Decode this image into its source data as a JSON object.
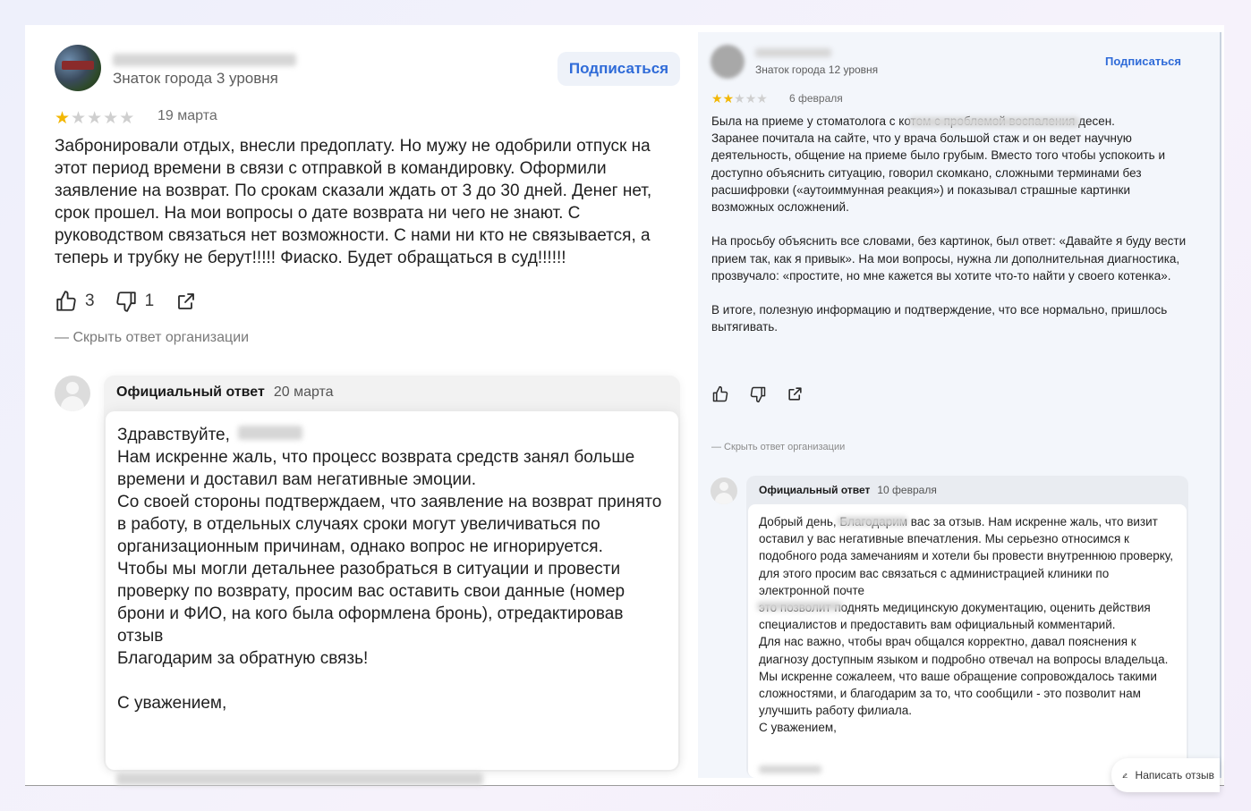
{
  "left_review": {
    "author_level": "Знаток города 3 уровня",
    "subscribe_label": "Подписаться",
    "rating": 1,
    "date": "19 марта",
    "text": "Забронировали отдых, внесли предоплату. Но мужу не одобрили отпуск на этот период времени в связи с отправкой в командировку. Оформили заявление на возврат. По срокам сказали ждать от 3 до 30 дней. Денег нет, срок прошел. На мои вопросы о дате возврата ни чего не знают. С руководством связаться нет возможности. С нами ни кто не связывается, а теперь и трубку не берут!!!!! Фиаско. Будет обращаться в суд!!!!!!",
    "likes": "3",
    "dislikes": "1",
    "hide_answer_label": "— Скрыть ответ организации",
    "answer": {
      "title": "Официальный ответ",
      "date": "20 марта",
      "text": "Здравствуйте, \nНам искренне жаль, что процесс возврата средств занял больше времени и доставил вам негативные эмоции.\nСо своей стороны подтверждаем, что заявление на возврат принято в работу, в отдельных случаях сроки могут увеличиваться по организационным причинам, однако вопрос не игнорируется.\nЧтобы мы могли детальнее разобраться в ситуации и провести проверку по возврату, просим вас оставить свои данные (номер брони и ФИО, на кого была оформлена бронь), отредактировав отзыв\nБлагодарим за обратную связь!\n\nС уважением,"
    }
  },
  "right_review": {
    "author_level": "Знаток города 12 уровня",
    "subscribe_label": "Подписаться",
    "rating": 2,
    "date": "6 февраля",
    "text": "Была на приеме у стоматолога                                          с котом с проблемой воспаления десен.\nЗаранее почитала на сайте, что у врача большой стаж и он ведет научную деятельность, общение на приеме было грубым. Вместо того чтобы успокоить и доступно объяснить ситуацию, говорил скомкано, сложными терминами без расшифровки («аутоиммунная реакция») и показывал страшные картинки возможных осложнений.\n\nНа просьбу объяснить все словами, без картинок, был ответ: «Давайте я буду вести прием так, как я привык». На мои вопросы, нужна ли дополнительная диагностика, прозвучало: «простите, но мне кажется вы хотите что-то найти у своего котенка».\n\nВ итоге, полезную информацию и подтверждение, что все нормально, пришлось вытягивать.",
    "hide_answer_label": "— Скрыть ответ организации",
    "answer": {
      "title": "Официальный ответ",
      "date": "10 февраля",
      "text": "Добрый день,                  Благодарим вас за отзыв. Нам искренне жаль, что визит оставил у вас негативные впечатления. Мы серьезно относимся к подобного рода замечаниям и хотели бы провести внутреннюю проверку, для этого просим вас связаться с администрацией клиники по электронной почте\n                          это позволит поднять медицинскую документацию, оценить действия специалистов и предоставить вам официальный комментарий.\nДля нас важно, чтобы врач общался корректно, давал пояснения к диагнозу доступным языком и подробно отвечал на вопросы владельца.\nМы искренне сожалеем, что ваше обращение сопровождалось такими сложностями, и благодарим за то, что сообщили - это позволит нам улучшить работу филиала.\nС уважением,"
    },
    "write_review_label": "Написать отзыв"
  },
  "icons": [
    "thumb-up-icon",
    "thumb-down-icon",
    "share-icon",
    "pencil-icon",
    "star-icon"
  ],
  "colors": {
    "accent": "#2f6bd8",
    "star": "#f2b705",
    "subscribe_bg": "#eef2f9"
  }
}
